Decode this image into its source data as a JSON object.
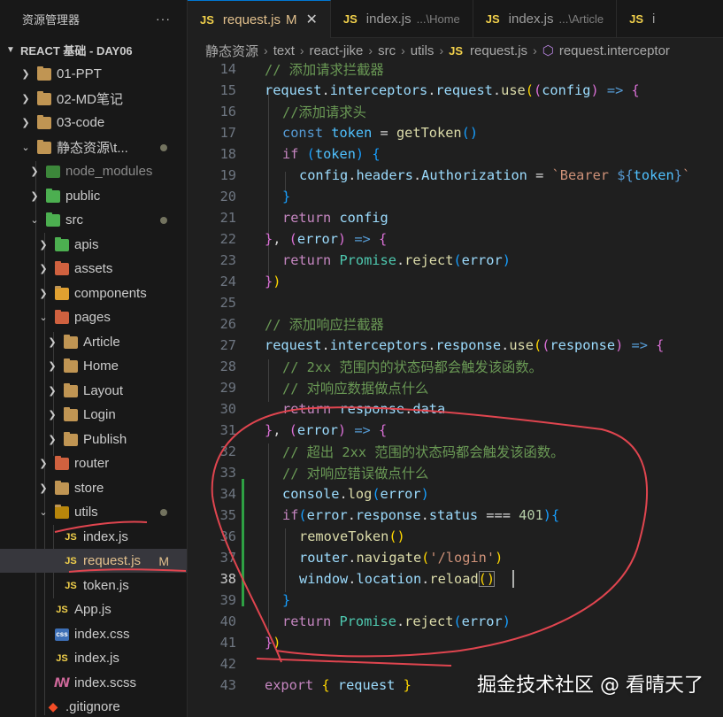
{
  "sidebar": {
    "title": "资源管理器",
    "more": "···",
    "section": "REACT 基础 - DAY06",
    "items": [
      {
        "label": "01-PPT",
        "icon": "folder-icon"
      },
      {
        "label": "02-MD笔记",
        "icon": "folder-icon"
      },
      {
        "label": "03-code",
        "icon": "folder-icon"
      },
      {
        "label": "静态资源\\t...",
        "icon": "folder-open-icon"
      },
      {
        "label": "node_modules",
        "icon": "node-folder-icon"
      },
      {
        "label": "public",
        "icon": "public-folder-icon"
      },
      {
        "label": "src",
        "icon": "src-folder-icon"
      },
      {
        "label": "apis",
        "icon": "apis-folder-icon"
      },
      {
        "label": "assets",
        "icon": "assets-folder-icon"
      },
      {
        "label": "components",
        "icon": "components-folder-icon"
      },
      {
        "label": "pages",
        "icon": "pages-folder-icon"
      },
      {
        "label": "Article",
        "icon": "folder-icon"
      },
      {
        "label": "Home",
        "icon": "folder-icon"
      },
      {
        "label": "Layout",
        "icon": "folder-icon"
      },
      {
        "label": "Login",
        "icon": "folder-icon"
      },
      {
        "label": "Publish",
        "icon": "folder-icon"
      },
      {
        "label": "router",
        "icon": "router-folder-icon"
      },
      {
        "label": "store",
        "icon": "folder-icon"
      },
      {
        "label": "utils",
        "icon": "utils-folder-icon"
      },
      {
        "label": "index.js",
        "icon": "js-file-icon"
      },
      {
        "label": "request.js",
        "icon": "js-file-icon",
        "badge": "M"
      },
      {
        "label": "token.js",
        "icon": "js-file-icon"
      },
      {
        "label": "App.js",
        "icon": "js-file-icon"
      },
      {
        "label": "index.css",
        "icon": "css-file-icon"
      },
      {
        "label": "index.js",
        "icon": "js-file-icon"
      },
      {
        "label": "index.scss",
        "icon": "scss-file-icon"
      },
      {
        "label": ".gitignore",
        "icon": "git-file-icon"
      }
    ],
    "icon_glyphs": {
      "js": "JS",
      "css": "css"
    }
  },
  "tabs": [
    {
      "label": "request.js",
      "badge": "M",
      "close": "✕",
      "active": true
    },
    {
      "label": "index.js",
      "desc": "...\\Home"
    },
    {
      "label": "index.js",
      "desc": "...\\Article"
    },
    {
      "label": "i"
    }
  ],
  "breadcrumb": [
    "静态资源",
    "text",
    "react-jike",
    "src",
    "utils",
    "request.js",
    "request.interceptor"
  ],
  "code": {
    "line_numbers": [
      "14",
      "15",
      "16",
      "17",
      "18",
      "19",
      "20",
      "21",
      "22",
      "23",
      "24",
      "25",
      "26",
      "27",
      "28",
      "29",
      "30",
      "31",
      "32",
      "33",
      "34",
      "35",
      "36",
      "37",
      "38",
      "39",
      "40",
      "41",
      "42",
      "43"
    ],
    "current_line": "38",
    "texts": {
      "l14_comment": "// 添加请求拦截器",
      "l15_a": "request",
      "l15_b": ".",
      "l15_c": "interceptors",
      "l15_d": ".",
      "l15_e": "request",
      "l15_f": ".",
      "l15_g": "use",
      "l15_h": "(",
      "l15_i": "(",
      "l15_j": "config",
      "l15_k": ")",
      "l15_l": " => ",
      "l15_m": "{",
      "l16_comment": "//添加请求头",
      "l17_a": "const ",
      "l17_b": "token",
      "l17_c": " = ",
      "l17_d": "getToken",
      "l17_e": "()",
      "l18_a": "if ",
      "l18_b": "(",
      "l18_c": "token",
      "l18_d": ")",
      "l18_e": " {",
      "l19_a": "config",
      "l19_b": ".",
      "l19_c": "headers",
      "l19_d": ".",
      "l19_e": "Authorization",
      "l19_f": " = ",
      "l19_g": "`Bearer ",
      "l19_h": "${",
      "l19_i": "token",
      "l19_j": "}",
      "l19_k": "`",
      "l20_a": "}",
      "l21_a": "return ",
      "l21_b": "config",
      "l22_a": "}",
      "l22_b": ", ",
      "l22_c": "(",
      "l22_d": "error",
      "l22_e": ")",
      "l22_f": " => ",
      "l22_g": "{",
      "l23_a": "return ",
      "l23_b": "Promise",
      "l23_c": ".",
      "l23_d": "reject",
      "l23_e": "(",
      "l23_f": "error",
      "l23_g": ")",
      "l24_a": "}",
      "l24_b": ")",
      "l26_comment": "// 添加响应拦截器",
      "l27_a": "request",
      "l27_b": ".",
      "l27_c": "interceptors",
      "l27_d": ".",
      "l27_e": "response",
      "l27_f": ".",
      "l27_g": "use",
      "l27_h": "(",
      "l27_i": "(",
      "l27_j": "response",
      "l27_k": ")",
      "l27_l": " => ",
      "l27_m": "{",
      "l28_comment": "// 2xx 范围内的状态码都会触发该函数。",
      "l29_comment": "// 对响应数据做点什么",
      "l30_a": "return ",
      "l30_b": "response",
      "l30_c": ".",
      "l30_d": "data",
      "l31_a": "}",
      "l31_b": ", ",
      "l31_c": "(",
      "l31_d": "error",
      "l31_e": ")",
      "l31_f": " => ",
      "l31_g": "{",
      "l32_comment": "// 超出 2xx 范围的状态码都会触发该函数。",
      "l33_comment": "// 对响应错误做点什么",
      "l34_a": "console",
      "l34_b": ".",
      "l34_c": "log",
      "l34_d": "(",
      "l34_e": "error",
      "l34_f": ")",
      "l35_a": "if",
      "l35_b": "(",
      "l35_c": "error",
      "l35_d": ".",
      "l35_e": "response",
      "l35_f": ".",
      "l35_g": "status",
      "l35_h": " === ",
      "l35_i": "401",
      "l35_j": ")",
      "l35_k": "{",
      "l36_a": "removeToken",
      "l36_b": "()",
      "l37_a": "router",
      "l37_b": ".",
      "l37_c": "navigate",
      "l37_d": "(",
      "l37_e": "'/login'",
      "l37_f": ")",
      "l38_a": "window",
      "l38_b": ".",
      "l38_c": "location",
      "l38_d": ".",
      "l38_e": "reload",
      "l38_f": "()",
      "l39_a": "}",
      "l40_a": "return ",
      "l40_b": "Promise",
      "l40_c": ".",
      "l40_d": "reject",
      "l40_e": "(",
      "l40_f": "error",
      "l40_g": ")",
      "l41_a": "}",
      "l41_b": ")",
      "l43_a": "export ",
      "l43_b": "{ ",
      "l43_c": "request",
      "l43_d": " }"
    }
  },
  "watermark": "掘金技术社区 @ 看晴天了",
  "colors": {
    "annotation": "#e0454f",
    "git_added": "#2ea043",
    "modified": "#e2c08d"
  }
}
